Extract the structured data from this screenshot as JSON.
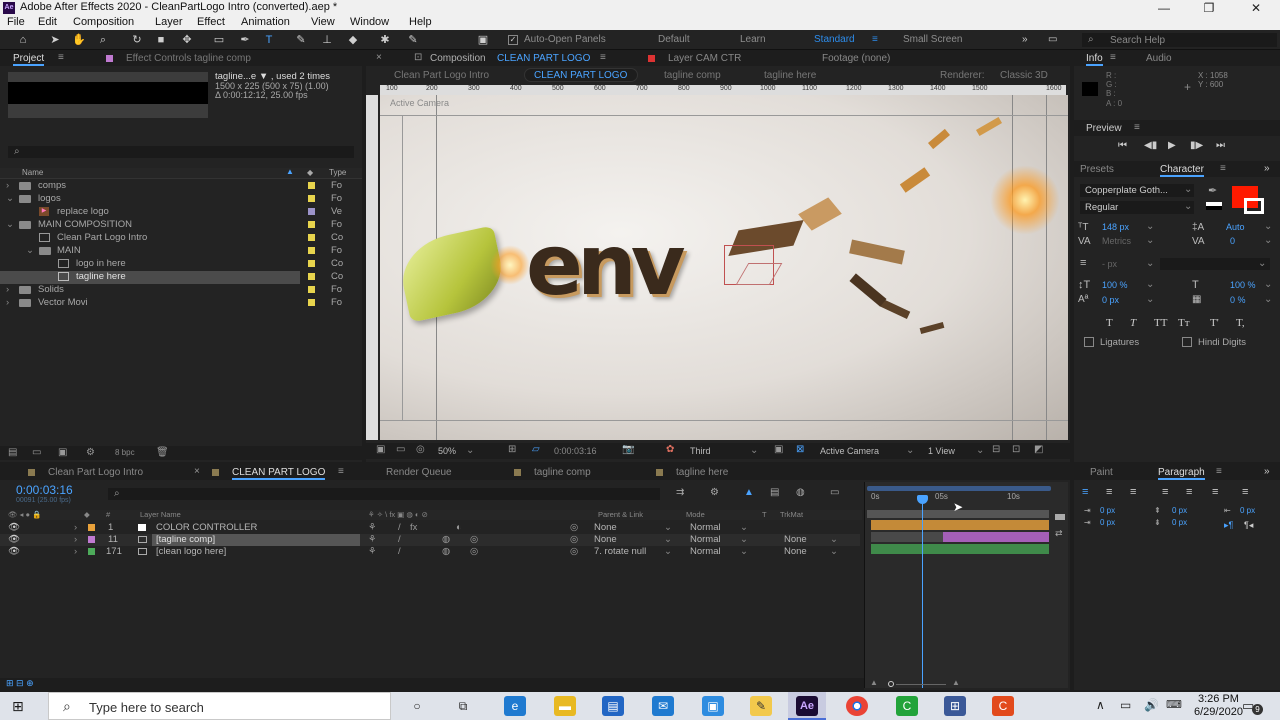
{
  "window": {
    "title": "Adobe After Effects 2020 - CleanPartLogo Intro (converted).aep *",
    "app_icon": "Ae",
    "controls": [
      "—",
      "❐",
      "✕"
    ]
  },
  "menu": [
    "File",
    "Edit",
    "Composition",
    "Layer",
    "Effect",
    "Animation",
    "View",
    "Window",
    "Help"
  ],
  "toolbar": {
    "auto_open": "Auto-Open Panels",
    "workspaces": [
      "Default",
      "Learn",
      "Standard",
      "Small Screen"
    ],
    "active_workspace": "Standard",
    "search_placeholder": "Search Help"
  },
  "project": {
    "tab": "Project",
    "effect_controls": "Effect Controls tagline comp",
    "item_name": "tagline...e ▼ , used 2 times",
    "item_size": "1500 x 225  (500 x 75) (1.00)",
    "item_dur": "Δ 0:00:12:12, 25.00 fps",
    "col_name": "Name",
    "col_type": "Type",
    "bpc": "8 bpc",
    "items": [
      {
        "name": "comps",
        "type": "Fo",
        "indent": 0
      },
      {
        "name": "logos",
        "type": "Fo",
        "indent": 0
      },
      {
        "name": "replace logo",
        "type": "Ve",
        "indent": 1
      },
      {
        "name": "MAIN COMPOSITION",
        "type": "Fo",
        "indent": 0
      },
      {
        "name": "Clean Part Logo Intro",
        "type": "Co",
        "indent": 1
      },
      {
        "name": "MAIN",
        "type": "Fo",
        "indent": 1
      },
      {
        "name": "logo in here",
        "type": "Co",
        "indent": 2
      },
      {
        "name": "tagline here",
        "type": "Co",
        "indent": 2
      },
      {
        "name": "Solids",
        "type": "Fo",
        "indent": 0
      },
      {
        "name": "Vector Movi",
        "type": "Fo",
        "indent": 0
      }
    ]
  },
  "viewer": {
    "comp_tab_prefix": "Composition",
    "comp_tab_name": "CLEAN PART LOGO",
    "layer_tab": "Layer CAM CTR",
    "footage_tab": "Footage (none)",
    "breadcrumbs": [
      "Clean Part Logo Intro",
      "CLEAN PART LOGO",
      "tagline comp",
      "tagline here"
    ],
    "renderer_label": "Renderer:",
    "renderer": "Classic 3D",
    "camera_label": "Active Camera",
    "ruler": [
      "100",
      "200",
      "300",
      "400",
      "500",
      "600",
      "700",
      "800",
      "900",
      "1000",
      "1100",
      "1200",
      "1300",
      "1400",
      "1500",
      "1600"
    ],
    "logo_text": "env",
    "zoom": "50%",
    "timecode": "0:00:03:16",
    "resolution": "Third",
    "view_camera": "Active Camera",
    "views": "1 View"
  },
  "info": {
    "tab": "Info",
    "audio_tab": "Audio",
    "r": "R :",
    "g": "G :",
    "b": "B :",
    "a": "A : 0",
    "x": "X : 1058",
    "y": "Y : 600"
  },
  "preview": {
    "tab": "Preview"
  },
  "character": {
    "presets_tab": "Presets",
    "tab": "Character",
    "font": "Copperplate Goth...",
    "style": "Regular",
    "size": "148 px",
    "leading": "Auto",
    "kerning": "Metrics",
    "tracking": "0",
    "stroke": "- px",
    "vscale": "100 %",
    "hscale": "100 %",
    "baseline": "0 px",
    "tsume": "0 %",
    "styles": [
      "T",
      "T",
      "TT",
      "Tт",
      "T'",
      "T,"
    ],
    "ligatures": "Ligatures",
    "hindi": "Hindi Digits",
    "fill_color": "#ff1a00"
  },
  "paragraph": {
    "paint_tab": "Paint",
    "tab": "Paragraph",
    "v1": "0 px",
    "v2": "0 px",
    "v3": "0 px",
    "v4": "0 px",
    "v5": "0 px"
  },
  "timeline": {
    "tabs": [
      "Clean Part Logo Intro",
      "CLEAN PART LOGO",
      "Render Queue",
      "tagline comp",
      "tagline here"
    ],
    "active_tab": "CLEAN PART LOGO",
    "timecode": "0:00:03:16",
    "frames": "00091 (25.00 fps)",
    "headers": {
      "name": "Layer Name",
      "parent": "Parent & Link",
      "mode": "Mode",
      "t": "T",
      "trkmat": "TrkMat"
    },
    "time_labels": [
      "0s",
      "05s",
      "10s"
    ],
    "layers": [
      {
        "num": "1",
        "name": "COLOR CONTROLLER",
        "color": "#e8a13a",
        "parent": "None",
        "mode": "Normal",
        "trk": ""
      },
      {
        "num": "11",
        "name": "[tagline comp]",
        "color": "#c07ad1",
        "parent": "None",
        "mode": "Normal",
        "trk": "None"
      },
      {
        "num": "171",
        "name": "[clean logo here]",
        "color": "#4dab5a",
        "parent": "7. rotate null",
        "mode": "Normal",
        "trk": "None"
      }
    ]
  },
  "taskbar": {
    "search": "Type here to search",
    "time": "3:26 PM",
    "date": "6/29/2020",
    "notif": "9"
  }
}
